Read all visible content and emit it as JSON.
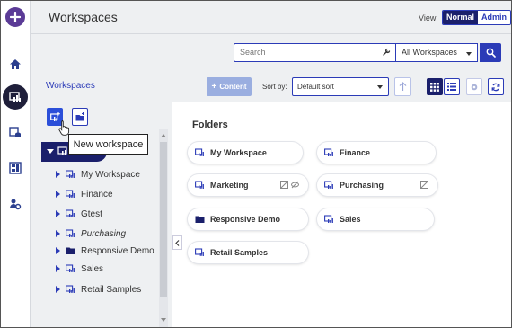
{
  "header": {
    "title": "Workspaces",
    "view_label": "View",
    "view_options": [
      "Normal",
      "Admin"
    ],
    "view_selected": "Normal"
  },
  "search": {
    "placeholder": "Search",
    "scope": "All Workspaces"
  },
  "toolbar": {
    "breadcrumb": "Workspaces",
    "content_button": "Content",
    "sort_by_label": "Sort by:",
    "sort_value": "Default sort"
  },
  "tree": {
    "tooltip": "New workspace",
    "items": [
      {
        "label": "My Workspace",
        "icon": "workspace-icon",
        "italic": false
      },
      {
        "label": "Finance",
        "icon": "workspace-icon",
        "italic": false
      },
      {
        "label": "Gtest",
        "icon": "workspace-icon",
        "italic": false
      },
      {
        "label": "Purchasing",
        "icon": "workspace-icon",
        "italic": true
      },
      {
        "label": "Responsive Demo",
        "icon": "folder-icon",
        "italic": false
      },
      {
        "label": "Sales",
        "icon": "workspace-icon",
        "italic": false
      },
      {
        "label": "Retail Samples",
        "icon": "workspace-icon",
        "italic": false
      }
    ]
  },
  "folders": {
    "heading": "Folders",
    "cards": [
      {
        "label": "My Workspace",
        "icon": "workspace-icon"
      },
      {
        "label": "Finance",
        "icon": "workspace-icon"
      },
      {
        "label": "Marketing",
        "icon": "workspace-icon"
      },
      {
        "label": "Purchasing",
        "icon": "workspace-icon"
      },
      {
        "label": "Responsive Demo",
        "icon": "folder-icon"
      },
      {
        "label": "Sales",
        "icon": "workspace-icon"
      },
      {
        "label": "Retail Samples",
        "icon": "workspace-icon"
      }
    ]
  },
  "colors": {
    "accent": "#2b3bb7",
    "dark": "#1a1f6b",
    "brand_purple": "#5b3b96"
  }
}
